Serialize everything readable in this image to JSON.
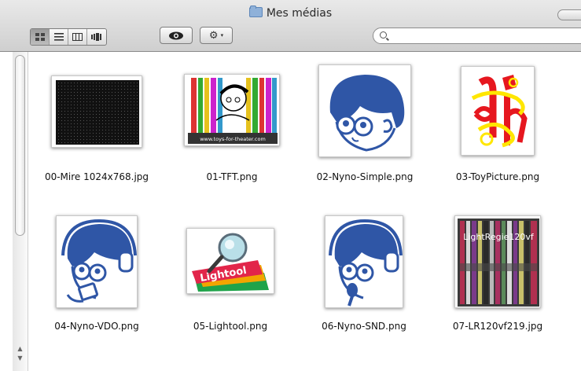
{
  "window": {
    "title": "Mes médias"
  },
  "toolbar": {
    "view_buttons": [
      {
        "name": "icon-view",
        "icon": "grid-icon",
        "active": true
      },
      {
        "name": "list-view",
        "icon": "list-icon",
        "active": false
      },
      {
        "name": "column-view",
        "icon": "columns-icon",
        "active": false
      },
      {
        "name": "coverflow-view",
        "icon": "coverflow-icon",
        "active": false
      }
    ],
    "quicklook_icon": "eye-icon",
    "action_icon": "gear-icon",
    "action_glyph": "⚙",
    "action_caret": "▾",
    "search_value": ""
  },
  "files": [
    {
      "name": "00-Mire 1024x768.jpg"
    },
    {
      "name": "01-TFT.png",
      "caption": "www.toys-for-theater.com"
    },
    {
      "name": "02-Nyno-Simple.png"
    },
    {
      "name": "03-ToyPicture.png"
    },
    {
      "name": "04-Nyno-VDO.png"
    },
    {
      "name": "05-Lightool.png",
      "caption": "Lightool"
    },
    {
      "name": "06-Nyno-SND.png"
    },
    {
      "name": "07-LR120vf219.jpg",
      "caption": "LightRegie120vf"
    }
  ],
  "colors": {
    "accent_blue": "#2f56a6"
  }
}
